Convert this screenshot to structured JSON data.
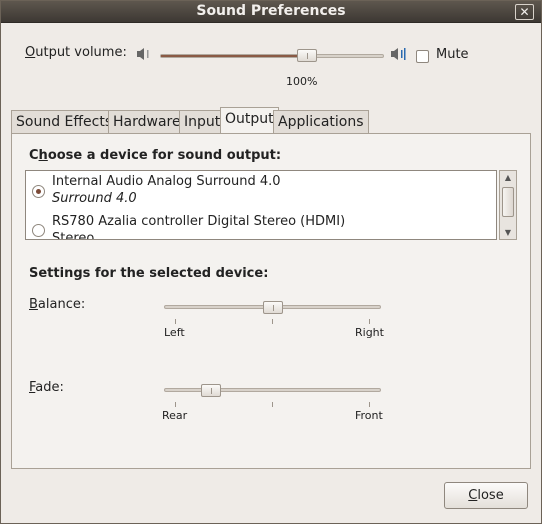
{
  "window": {
    "title": "Sound Preferences",
    "close_glyph": "✕"
  },
  "output_volume": {
    "label_accel": "O",
    "label_rest": "utput volume:",
    "value_text": "100%",
    "level": 0.67,
    "mute_label": "Mute",
    "mute_checked": false
  },
  "tabs": [
    {
      "label": "Sound Effects",
      "active": false
    },
    {
      "label": "Hardware",
      "active": false
    },
    {
      "label": "Input",
      "active": false
    },
    {
      "label": "Output",
      "active": true
    },
    {
      "label": "Applications",
      "active": false
    }
  ],
  "device_section": {
    "heading_pre": "C",
    "heading_accel": "h",
    "heading_rest": "oose a device for sound output:",
    "devices": [
      {
        "name": "Internal Audio Analog Surround 4.0",
        "profile": "Surround 4.0",
        "selected": true
      },
      {
        "name": "RS780 Azalia controller Digital Stereo (HDMI)",
        "profile": "Stereo",
        "selected": false
      }
    ]
  },
  "settings": {
    "heading": "Settings for the selected device:",
    "balance": {
      "label_accel": "B",
      "label_rest": "alance:",
      "left_label": "Left",
      "right_label": "Right",
      "level": 0.5
    },
    "fade": {
      "label_accel": "F",
      "label_rest": "ade:",
      "left_label": "Rear",
      "right_label": "Front",
      "level": 0.19
    }
  },
  "footer": {
    "close_accel": "C",
    "close_rest": "lose"
  },
  "colors": {
    "accent": "#8a5a45",
    "titlebar": "#4a443d",
    "background": "#efebe7"
  }
}
